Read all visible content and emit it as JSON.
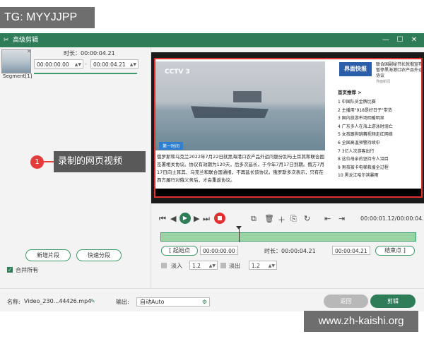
{
  "top_tag": "TG: MYYJJPP",
  "window": {
    "title": "高级剪辑",
    "controls": [
      "—",
      "☐",
      "✕"
    ]
  },
  "left_panel": {
    "segment_label": "Segment[1]",
    "duration_label": "时长：",
    "duration_value": "00:00:04.21",
    "start_time": "00:00:00.00",
    "end_time": "00:00:04.21",
    "separator": "-",
    "add_segment": "新增片段",
    "quick_split": "快速分段",
    "merge_all": "合并所有"
  },
  "callout": {
    "number": "1",
    "text": "录制的网页视频"
  },
  "preview": {
    "channel_logo": "CCTV 3",
    "video_label": "第一时间",
    "article": "俄罗斯和乌克兰2022年7月22日就黑海港口农产品外运问题分别与土耳其和联合国签署相关协议。协议有效期为120天，后多次延长，于今年7月17日到期。俄方7月17日向土耳其、乌克兰和联合国通报，不再延长该协议。俄罗斯多次表示，只有在西方履行对俄义务后，才会重返协议。",
    "site_logo": "界面快报",
    "headline": "联合国副秘书长就俄宣布暂停黑海港口农产品外运协议",
    "headline_source": "界面新闻",
    "hot_title": "首页推荐 >",
    "hot_list": [
      "1 中国队员金牌比赛",
      "2 主播用\"918是好日子\"带货",
      "3 国内旅游市场回暖明显",
      "4 广东多人在海上游泳时溺亡",
      "5 女孩跟狗跳舞视频走红网络",
      "6 全国高温预警持续中",
      "7 3亿人次游客出行",
      "8 这位母亲的坚持令人泪目",
      "9 男孩被卡电梯救援全过程",
      "10 黑龙江哈尔滨暴雨"
    ]
  },
  "player": {
    "timecode": "00:00:01.12/00:00:04.21",
    "start_point": "起始点",
    "start_value": "00:00:00.00",
    "duration_label": "时长：",
    "duration_value": "00:00:04.21",
    "end_value": "00:00:04.21",
    "end_point": "结束点",
    "fade_in": "淡入",
    "fade_in_value": "1.2",
    "fade_out": "淡出",
    "fade_out_value": "1.2"
  },
  "footer": {
    "name_label": "名称:",
    "name_value": "Video_230...44426.mp4",
    "output_label": "输出:",
    "output_value": "自动Auto",
    "back": "返回",
    "edit": "剪辑"
  },
  "watermark": "www.zh-kaishi.org"
}
